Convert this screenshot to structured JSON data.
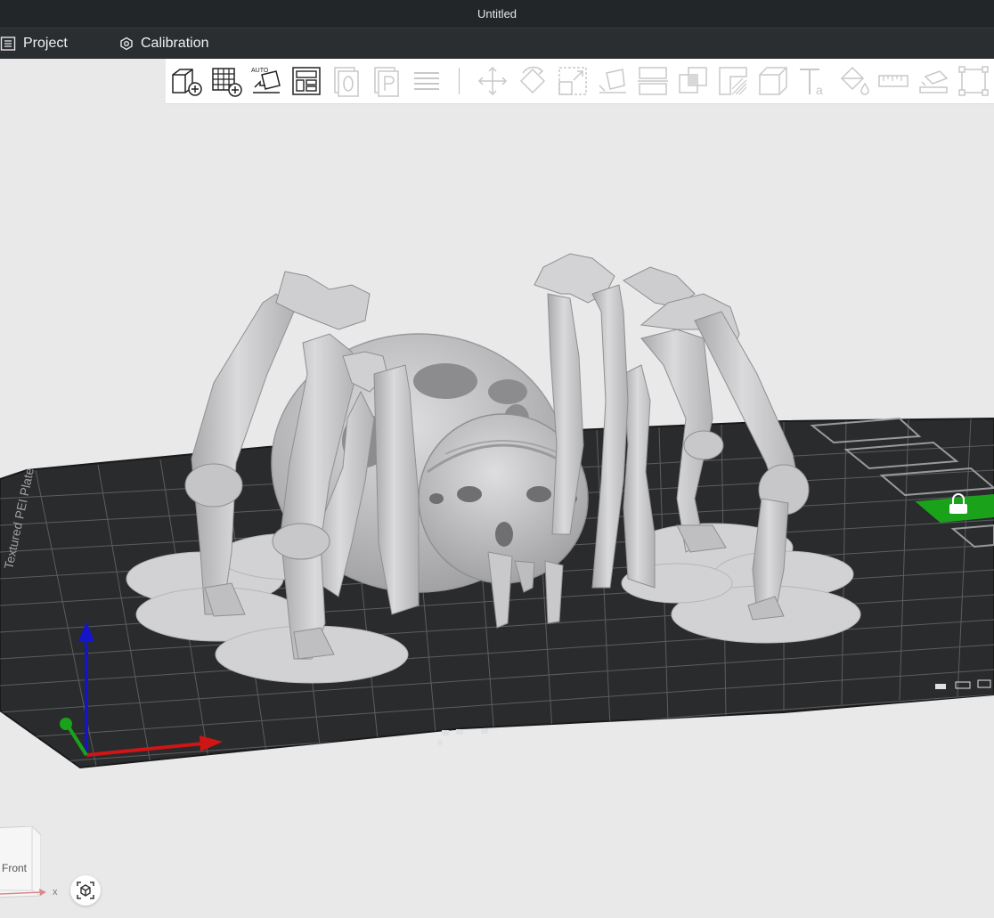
{
  "window": {
    "title": "Untitled"
  },
  "menu": {
    "project_label": "Project",
    "calibration_label": "Calibration"
  },
  "toolbar": {
    "tools": [
      "add-object-icon",
      "add-plate-icon",
      "auto-orient-icon",
      "arrange-icon",
      "slice-plate-0-icon",
      "slice-plate-p-icon",
      "layers-icon",
      "move-icon",
      "rotate-icon",
      "scale-icon",
      "lay-on-face-icon",
      "cut-icon",
      "boolean-icon",
      "support-paint-icon",
      "seam-paint-icon",
      "measure-box-icon",
      "text-icon",
      "color-paint-icon",
      "ruler-icon",
      "assembly-icon",
      "fit-frame-icon"
    ]
  },
  "plate": {
    "label": "Textured PEI Plate"
  },
  "view": {
    "navcube_face": "Front",
    "axis_x_label": "x"
  },
  "colors": {
    "titlebar": "#232629",
    "menubar": "#2b2e31",
    "viewport_bg": "#e9e9ea",
    "plate": "#2a2b2d",
    "model": "#c8c8ca",
    "axis_x": "#d01515",
    "axis_y": "#1aa31a",
    "axis_z": "#1515c8",
    "lock_button": "#1aa31a"
  }
}
